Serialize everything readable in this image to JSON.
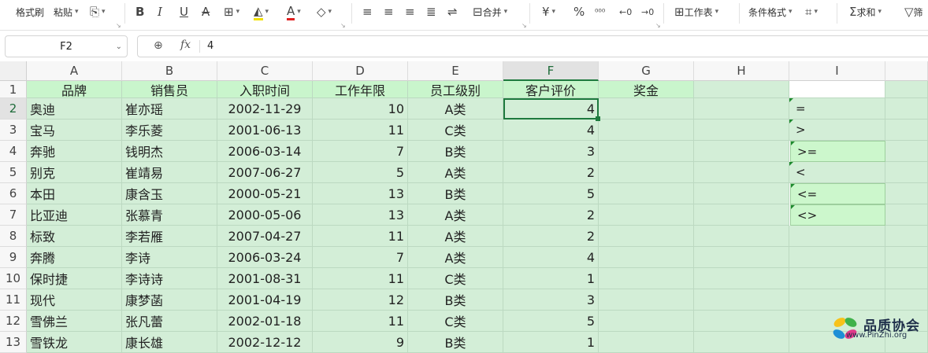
{
  "toolbar": {
    "format_painter": "格式刷",
    "paste": "粘贴",
    "bold": "B",
    "italic": "I",
    "underline": "U",
    "strike": "A",
    "merge": "合并",
    "currency": "¥",
    "percent": "%",
    "worksheet": "工作表",
    "conditional_format": "条件格式",
    "sum": "求和",
    "filter": "筛"
  },
  "formula_bar": {
    "cell_ref": "F2",
    "fx": "fx",
    "value": "4"
  },
  "columns": [
    "A",
    "B",
    "C",
    "D",
    "E",
    "F",
    "G",
    "H",
    "I"
  ],
  "rows": [
    "1",
    "2",
    "3",
    "4",
    "5",
    "6",
    "7",
    "8",
    "9",
    "10",
    "11",
    "12",
    "13"
  ],
  "headers": [
    "品牌",
    "销售员",
    "入职时间",
    "工作年限",
    "员工级别",
    "客户评价",
    "奖金"
  ],
  "data": [
    [
      "奥迪",
      "崔亦瑶",
      "2002-11-29",
      "10",
      "A类",
      "4"
    ],
    [
      "宝马",
      "李乐菱",
      "2001-06-13",
      "11",
      "C类",
      "4"
    ],
    [
      "奔驰",
      "钱明杰",
      "2006-03-14",
      "7",
      "B类",
      "3"
    ],
    [
      "别克",
      "崔靖易",
      "2007-06-27",
      "5",
      "A类",
      "2"
    ],
    [
      "本田",
      "康含玉",
      "2000-05-21",
      "13",
      "B类",
      "5"
    ],
    [
      "比亚迪",
      "张慕青",
      "2000-05-06",
      "13",
      "A类",
      "2"
    ],
    [
      "标致",
      "李若雁",
      "2007-04-27",
      "11",
      "A类",
      "2"
    ],
    [
      "奔腾",
      "李诗",
      "2006-03-24",
      "7",
      "A类",
      "4"
    ],
    [
      "保时捷",
      "李诗诗",
      "2001-08-31",
      "11",
      "C类",
      "1"
    ],
    [
      "现代",
      "康梦菡",
      "2001-04-19",
      "12",
      "B类",
      "3"
    ],
    [
      "雪佛兰",
      "张凡蕾",
      "2002-01-18",
      "11",
      "C类",
      "5"
    ],
    [
      "雪铁龙",
      "康长雄",
      "2002-12-12",
      "9",
      "B类",
      "1"
    ]
  ],
  "operators": [
    "=",
    ">",
    ">=",
    "<",
    "<=",
    "<>"
  ],
  "watermark": {
    "title": "品质协会",
    "url": "www.PinZhi.org"
  }
}
